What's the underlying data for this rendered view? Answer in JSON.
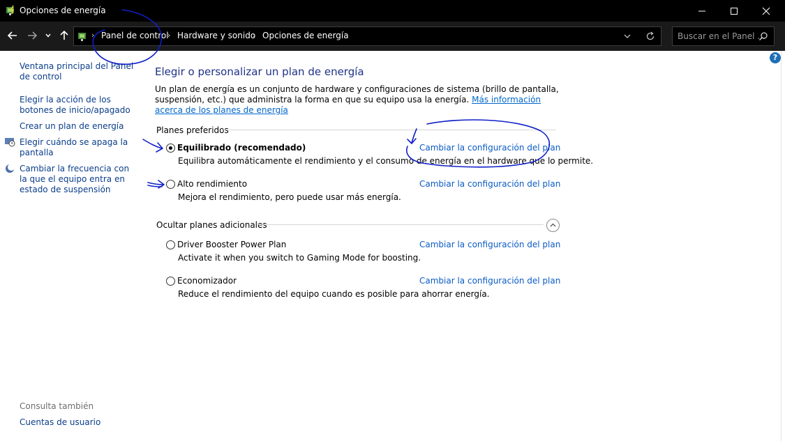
{
  "window": {
    "title": "Opciones de energía"
  },
  "nav": {
    "breadcrumbs": [
      "Panel de control",
      "Hardware y sonido",
      "Opciones de energía"
    ],
    "search_placeholder": "Buscar en el Panel ..."
  },
  "sidebar": {
    "links": [
      "Ventana principal del Panel de control",
      "Elegir la acción de los botones de inicio/apagado",
      "Crear un plan de energía",
      "Elegir cuándo se apaga la pantalla",
      "Cambiar la frecuencia con la que el equipo entra en estado de suspensión"
    ],
    "see_also_label": "Consulta también",
    "see_also_links": [
      "Cuentas de usuario"
    ]
  },
  "main": {
    "title": "Elegir o personalizar un plan de energía",
    "intro_text": "Un plan de energía es un conjunto de hardware y configuraciones de sistema (brillo de pantalla, suspensión, etc.) que administra la forma en que su equipo usa la energía.",
    "intro_link": "Más información acerca de los planes de energía",
    "preferred_label": "Planes preferidos",
    "hidden_label": "Ocultar planes adicionales",
    "change_link": "Cambiar la configuración del plan",
    "plans_preferred": [
      {
        "name": "Equilibrado (recomendado)",
        "desc": "Equilibra automáticamente el rendimiento y el consumo de energía en el hardware que lo permite.",
        "selected": true
      },
      {
        "name": "Alto rendimiento",
        "desc": "Mejora el rendimiento, pero puede usar más energía.",
        "selected": false
      }
    ],
    "plans_additional": [
      {
        "name": "Driver Booster Power Plan",
        "desc": "Activate it when you switch to Gaming Mode for boosting.",
        "selected": false
      },
      {
        "name": "Economizador",
        "desc": "Reduce el rendimiento del equipo cuando es posible para ahorrar energía.",
        "selected": false
      }
    ]
  },
  "icons": {
    "app": "power-options-icon",
    "back": "back-arrow-icon",
    "forward": "forward-arrow-icon",
    "recent": "chevron-down-icon",
    "up": "up-arrow-icon",
    "refresh": "refresh-icon",
    "search": "search-icon",
    "help": "help-icon"
  },
  "colors": {
    "link": "#0a5bc4",
    "title": "#1e3287",
    "annotation": "#1020c8"
  }
}
